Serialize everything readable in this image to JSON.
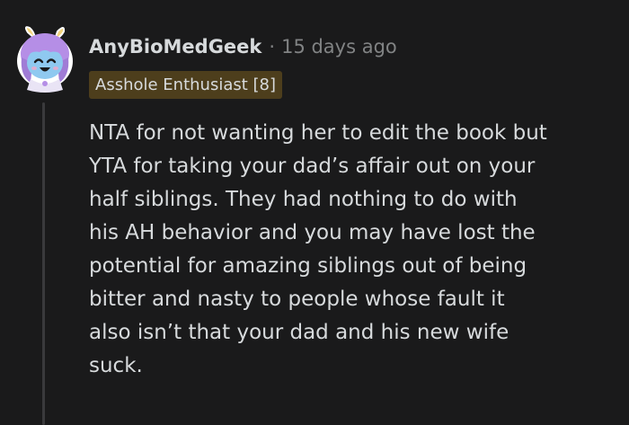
{
  "comment": {
    "author": "AnyBioMedGeek",
    "separator": "·",
    "timestamp": "15 days ago",
    "flair": "Asshole Enthusiast [8]",
    "body_lines": [
      "NTA for not wanting her to edit the book but",
      "YTA for taking your dad’s affair out on your",
      "half siblings. They had nothing to do with",
      "his AH behavior and you may have lost the",
      "potential for amazing siblings out of being",
      "bitter and nasty to people whose fault it",
      "also isn’t that your dad and his new wife",
      "suck."
    ],
    "avatar_icon": "snoo-avatar-icon"
  },
  "colors": {
    "background": "#1a1a1b",
    "text": "#d7dadc",
    "muted": "#818384",
    "flair_bg": "#4d3e1c",
    "thread_line": "#3a3a3c",
    "avatar_skin": "#8fc9f0",
    "avatar_hair": "#b58ee6"
  }
}
